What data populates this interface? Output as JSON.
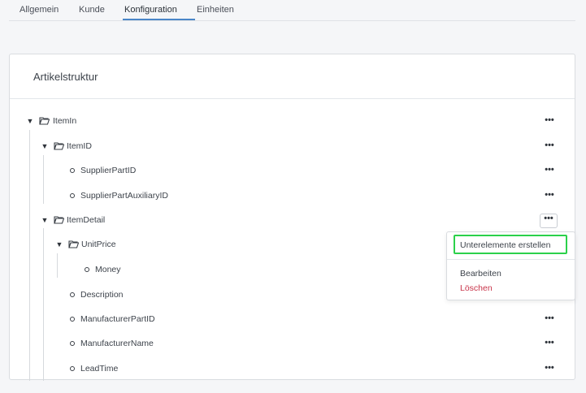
{
  "tabs": [
    "Allgemein",
    "Kunde",
    "Konfiguration",
    "Einheiten"
  ],
  "active_tab": "Konfiguration",
  "card": {
    "title": "Artikelstruktur"
  },
  "tree": {
    "item_in": "ItemIn",
    "item_id": "ItemID",
    "supplier_part_id": "SupplierPartID",
    "supplier_part_aux_id": "SupplierPartAuxiliaryID",
    "item_detail": "ItemDetail",
    "unit_price": "UnitPrice",
    "money": "Money",
    "description": "Description",
    "manufacturer_part_id": "ManufacturerPartID",
    "manufacturer_name": "ManufacturerName",
    "lead_time": "LeadTime"
  },
  "more_label": "•••",
  "menu": {
    "create_children": "Unterelemente erstellen",
    "edit": "Bearbeiten",
    "delete": "Löschen"
  },
  "colors": {
    "accent": "#4a86c8",
    "highlight": "#2bd14a",
    "danger": "#c8344a"
  }
}
